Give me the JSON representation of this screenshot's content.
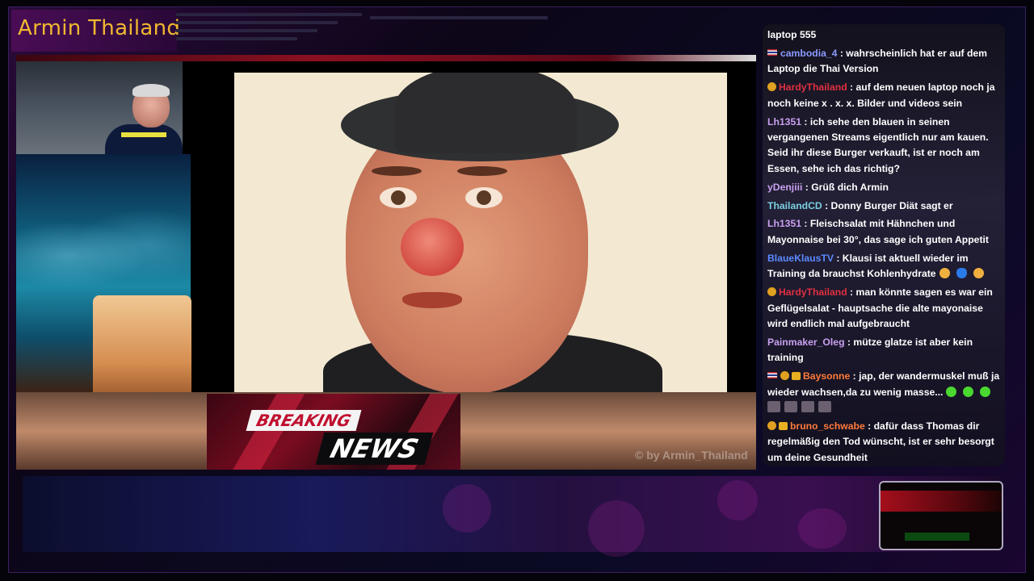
{
  "stream": {
    "channel_title": "Armin Thailand",
    "watermark": "© by Armin_Thailand"
  },
  "breaking_news": {
    "line1": "BREAKING",
    "line2": "NEWS"
  },
  "chat": {
    "messages": [
      {
        "user": "",
        "text": "laptop 555",
        "user_color": "#ffffff",
        "badges": []
      },
      {
        "user": "cambodia_4",
        "text": " : wahrscheinlich hat er auf dem Laptop die Thai Version",
        "user_color": "#8a9aff",
        "badges": [
          "flag"
        ]
      },
      {
        "user": "HardyThailand",
        "text": " : auf dem neuen laptop noch ja noch keine x . x. x. Bilder und videos sein",
        "user_color": "#e03040",
        "badges": [
          "icon"
        ]
      },
      {
        "user": "Lh1351",
        "text": " : ich sehe den blauen in seinen vergangenen Streams eigentlich nur am kauen. Seid ihr diese Burger verkauft, ist er noch am Essen, sehe ich das richtig?",
        "user_color": "#c9a0f0",
        "badges": []
      },
      {
        "user": "yDenjiii",
        "text": " : Grüß dich Armin",
        "user_color": "#c9a0f0",
        "badges": []
      },
      {
        "user": "ThailandCD",
        "text": " : Donny Burger Diät sagt er",
        "user_color": "#7ad0e0",
        "badges": []
      },
      {
        "user": "Lh1351",
        "text": " : Fleischsalat mit Hähnchen und Mayonnaise bei 30°, das sage ich guten Appetit",
        "user_color": "#c9a0f0",
        "badges": []
      },
      {
        "user": "BlaueKlausTV",
        "text": " : Klausi ist aktuell wieder im Training da brauchst Kohlenhydrate",
        "user_color": "#5a8aff",
        "badges": [],
        "emotes": [
          "laugh",
          "heart",
          "laugh"
        ]
      },
      {
        "user": "HardyThailand",
        "text": " : man könnte sagen es war ein Geflügelsalat - hauptsache die alte mayonaise wird endlich mal aufgebraucht",
        "user_color": "#e03040",
        "badges": [
          "icon"
        ]
      },
      {
        "user": "Painmaker_Oleg",
        "text": " : mütze glatze ist aber kein training",
        "user_color": "#c9a0f0",
        "badges": []
      },
      {
        "user": "Baysonne",
        "text": " : jap, der wandermuskel muß ja wieder wachsen,da zu wenig masse...",
        "user_color": "#ff7a3a",
        "badges": [
          "flag",
          "icon",
          "badge"
        ],
        "emotes": [
          "green",
          "green",
          "green"
        ],
        "extra_row": 4
      },
      {
        "user": "bruno_schwabe",
        "text": " : dafür dass Thomas dir regelmäßig den Tod wünscht, ist er sehr besorgt um deine Gesundheit",
        "user_color": "#ff7a3a",
        "badges": [
          "icon",
          "badge"
        ]
      }
    ]
  },
  "colors": {
    "title": "#f0b830",
    "chat_text": "#ffffff",
    "accent": "#7a0c20"
  }
}
